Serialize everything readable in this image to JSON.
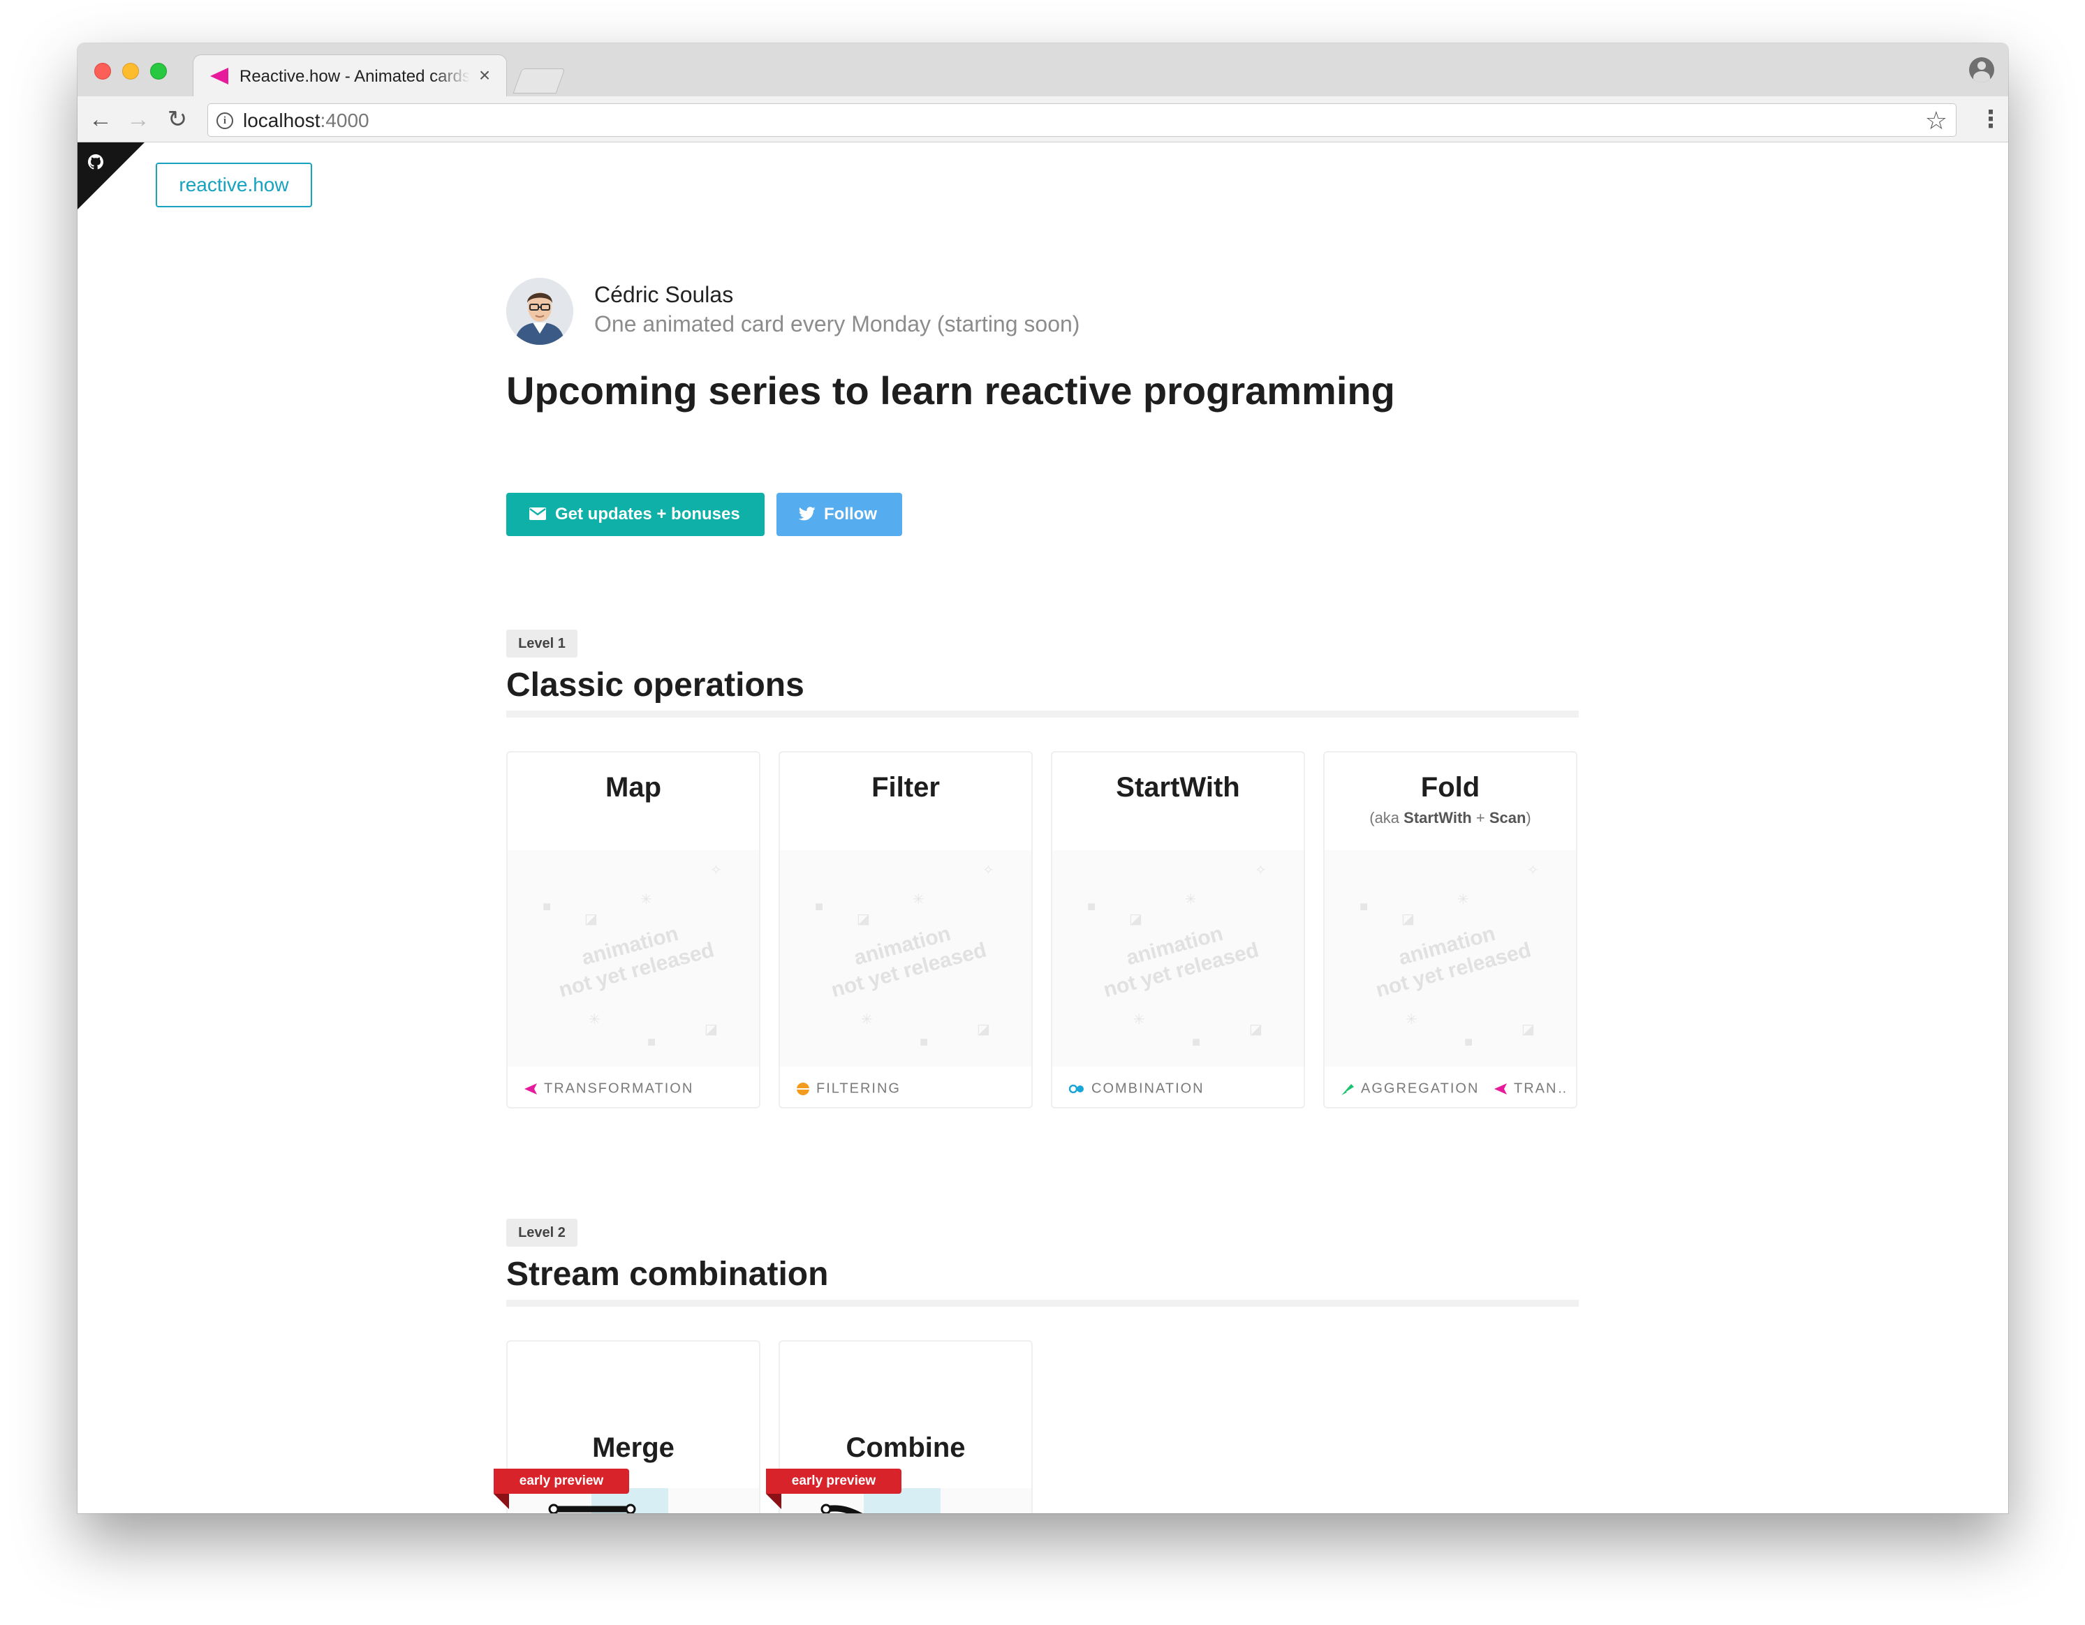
{
  "browser": {
    "tab": {
      "title": "Reactive.how - Animated cards",
      "close": "×"
    },
    "nav": {
      "back": "←",
      "forward": "→",
      "reload": "↻"
    },
    "url": {
      "host": "localhost",
      "port": ":4000",
      "info": "i"
    },
    "star": "☆",
    "menu": "⋮"
  },
  "header": {
    "brand_link": "reactive.how"
  },
  "author": {
    "name": "Cédric Soulas",
    "tagline": "One animated card every Monday (starting soon)"
  },
  "page_title": "Upcoming series to learn reactive programming",
  "buttons": {
    "updates": "Get updates + bonuses",
    "follow": "Follow"
  },
  "sections": [
    {
      "level": "Level 1",
      "title": "Classic operations",
      "cards": [
        {
          "title": "Map",
          "aka": "",
          "anim": [
            "animation",
            "not yet released"
          ],
          "tags": [
            {
              "icon": "transformation-icon",
              "color": "#e61a9a",
              "label": "TRANSFORMATION"
            }
          ]
        },
        {
          "title": "Filter",
          "aka": "",
          "anim": [
            "animation",
            "not yet released"
          ],
          "tags": [
            {
              "icon": "filtering-icon",
              "color": "#f29b1d",
              "label": "FILTERING"
            }
          ]
        },
        {
          "title": "StartWith",
          "aka": "",
          "anim": [
            "animation",
            "not yet released"
          ],
          "tags": [
            {
              "icon": "combination-icon",
              "color": "#1aa6d6",
              "label": "COMBINATION"
            }
          ]
        },
        {
          "title": "Fold",
          "aka": {
            "prefix": "(aka ",
            "a": "StartWith",
            "mid": " + ",
            "b": "Scan",
            "suffix": ")"
          },
          "anim": [
            "animation",
            "not yet released"
          ],
          "tags": [
            {
              "icon": "aggregation-icon",
              "color": "#19c36f",
              "label": "AGGREGATION"
            },
            {
              "icon": "transformation-icon",
              "color": "#e61a9a",
              "label": "TRAN…"
            }
          ]
        }
      ]
    },
    {
      "level": "Level 2",
      "title": "Stream combination",
      "cards": [
        {
          "title": "Merge",
          "ribbon": "early preview"
        },
        {
          "title": "Combine",
          "ribbon": "early preview"
        }
      ]
    }
  ],
  "colors": {
    "accent_teal": "#0fb0a7",
    "twitter_blue": "#55acee",
    "brand_cyan": "#17a2c0",
    "ribbon_red": "#d9232b"
  }
}
